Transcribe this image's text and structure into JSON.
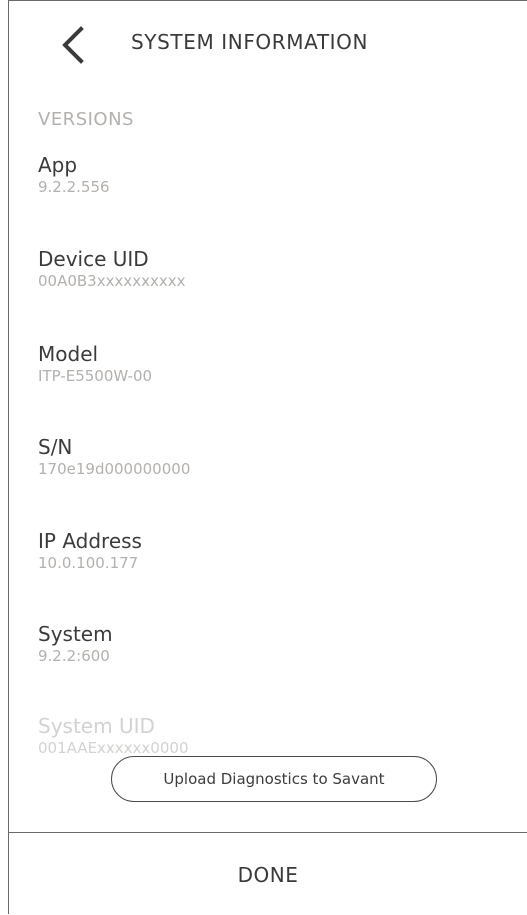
{
  "header": {
    "title": "SYSTEM INFORMATION",
    "back_icon": "chevron-left-icon"
  },
  "section": {
    "label": "VERSIONS"
  },
  "items": [
    {
      "label": "App",
      "value": "9.2.2.556"
    },
    {
      "label": "Device UID",
      "value": "00A0B3xxxxxxxxxx"
    },
    {
      "label": "Model",
      "value": "ITP-E5500W-00"
    },
    {
      "label": "S/N",
      "value": "170e19d000000000"
    },
    {
      "label": "IP Address",
      "value": "10.0.100.177"
    },
    {
      "label": "System",
      "value": "9.2.2:600"
    },
    {
      "label": "System UID",
      "value": "001AAExxxxxx0000"
    }
  ],
  "actions": {
    "upload_label": "Upload Diagnostics to Savant",
    "done_label": "DONE"
  }
}
